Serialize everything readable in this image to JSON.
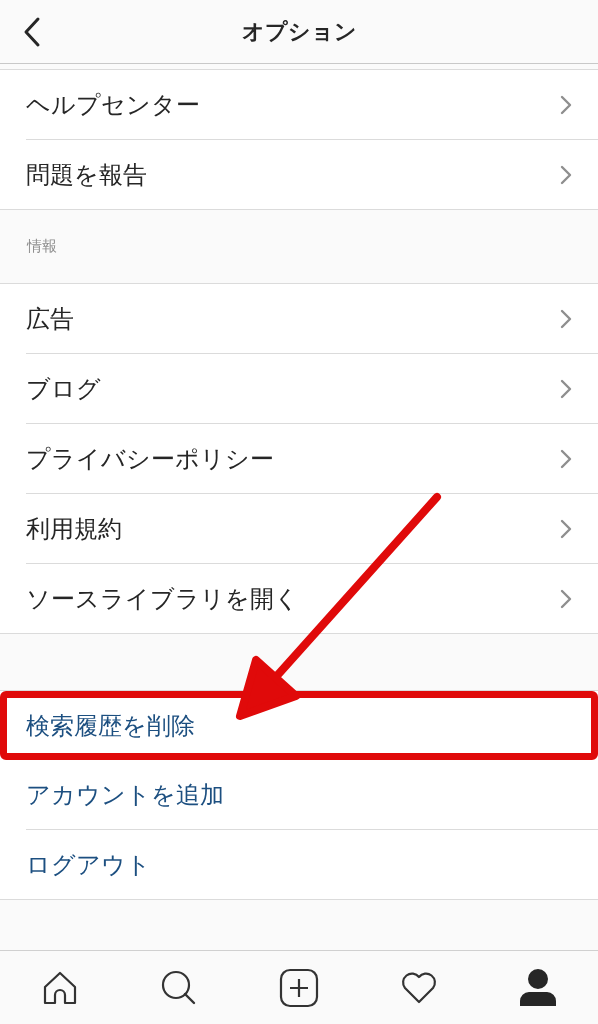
{
  "header": {
    "title": "オプション"
  },
  "groups": [
    {
      "items": [
        {
          "label": "ヘルプセンター"
        },
        {
          "label": "問題を報告"
        }
      ]
    },
    {
      "label": "情報",
      "items": [
        {
          "label": "広告"
        },
        {
          "label": "ブログ"
        },
        {
          "label": "プライバシーポリシー"
        },
        {
          "label": "利用規約"
        },
        {
          "label": "ソースライブラリを開く"
        }
      ]
    }
  ],
  "actions": [
    {
      "label": "検索履歴を削除",
      "highlighted": true
    },
    {
      "label": "アカウントを追加",
      "highlighted": false
    },
    {
      "label": "ログアウト",
      "highlighted": false
    }
  ],
  "tab_bar": [
    {
      "kind": "home",
      "selected": false
    },
    {
      "kind": "search",
      "selected": false
    },
    {
      "kind": "add",
      "selected": false
    },
    {
      "kind": "heart",
      "selected": false
    },
    {
      "kind": "profile",
      "selected": true
    }
  ]
}
